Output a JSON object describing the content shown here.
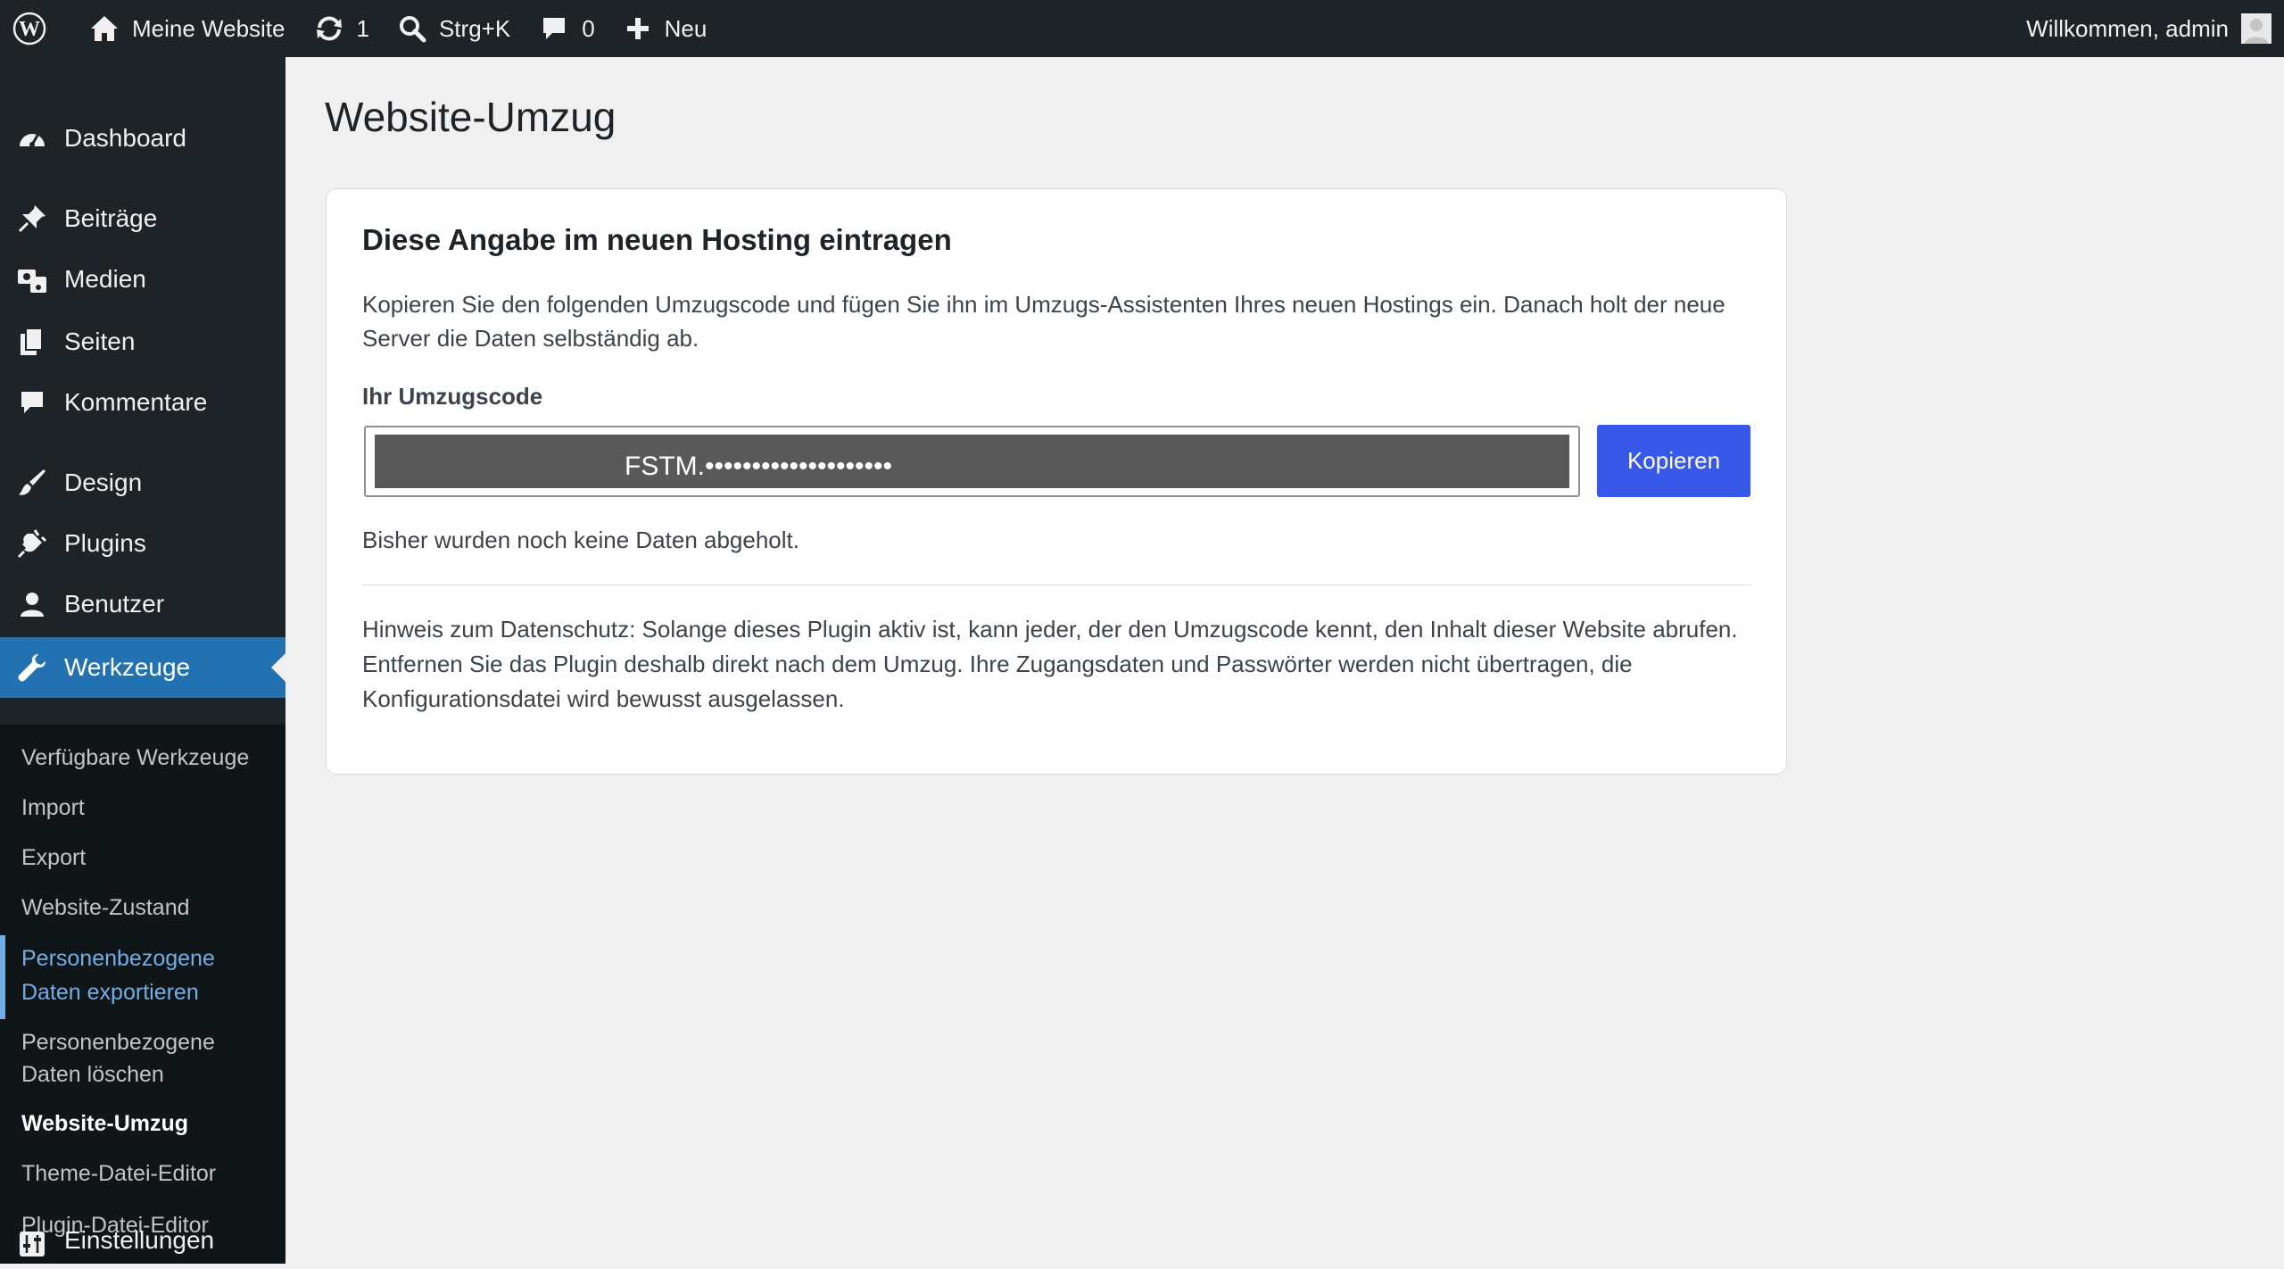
{
  "adminbar": {
    "site_name": "Meine Website",
    "updates_count": "1",
    "search_shortcut": "Strg+K",
    "comments_count": "0",
    "new_label": "Neu",
    "greeting": "Willkommen, admin"
  },
  "sidebar": {
    "items": [
      {
        "label": "Dashboard",
        "icon": "dashboard-icon"
      },
      {
        "label": "Beiträge",
        "icon": "pin-icon"
      },
      {
        "label": "Medien",
        "icon": "media-icon"
      },
      {
        "label": "Seiten",
        "icon": "pages-icon"
      },
      {
        "label": "Kommentare",
        "icon": "comment-icon"
      },
      {
        "label": "Design",
        "icon": "brush-icon"
      },
      {
        "label": "Plugins",
        "icon": "plugin-icon"
      },
      {
        "label": "Benutzer",
        "icon": "user-icon"
      },
      {
        "label": "Werkzeuge",
        "icon": "wrench-icon"
      },
      {
        "label": "Einstellungen",
        "icon": "settings-icon"
      }
    ],
    "submenu": [
      "Verfügbare Werkzeuge",
      "Import",
      "Export",
      "Website-Zustand",
      "Personenbezogene Daten exportieren",
      "Personenbezogene Daten löschen",
      "Website-Umzug",
      "Theme-Datei-Editor",
      "Plugin-Datei-Editor"
    ],
    "submenu_lines": {
      "export_1": "Personenbezogene",
      "export_2": "Daten exportieren",
      "delete_1": "Personenbezogene",
      "delete_2": "Daten löschen"
    }
  },
  "main": {
    "page_title": "Website-Umzug",
    "card": {
      "title": "Diese Angabe im neuen Hosting eintragen",
      "description": "Kopieren Sie den folgenden Umzugscode und fügen Sie ihn im Umzugs-Assistenten Ihres neuen Hostings ein. Danach holt der neue Server die Daten selbständig ab.",
      "code_label": "Ihr Umzugscode",
      "code_value": "FSTM.••••••••••••••••••••",
      "copy_button": "Kopieren",
      "status": "Bisher wurden noch keine Daten abgeholt.",
      "privacy_note": "Hinweis zum Datenschutz: Solange dieses Plugin aktiv ist, kann jeder, der den Umzugscode kennt, den Inhalt dieser Website abrufen. Entfernen Sie das Plugin deshalb direkt nach dem Umzug. Ihre Zugangsdaten und Passwörter werden nicht übertragen, die Konfigurationsdatei wird bewusst ausgelassen."
    }
  },
  "colors": {
    "adminbar_bg": "#1d2327",
    "menu_current": "#2271b1",
    "button": "#3858e9",
    "submenu_highlight": "#72aee6"
  }
}
